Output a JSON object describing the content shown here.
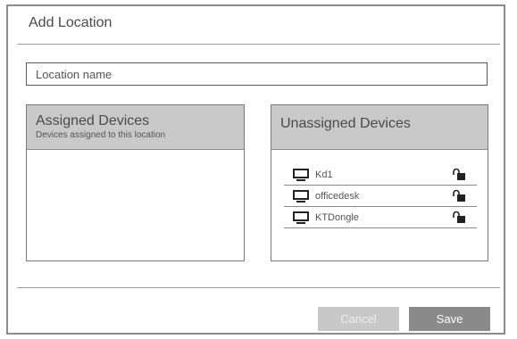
{
  "dialog": {
    "title": "Add Location"
  },
  "location_input": {
    "placeholder": "Location name",
    "value": ""
  },
  "assigned": {
    "title": "Assigned Devices",
    "subtitle": "Devices  assigned to this location",
    "items": []
  },
  "unassigned": {
    "title": "Unassigned Devices",
    "items": [
      {
        "name": "Kd1",
        "icon": "monitor-icon",
        "lock": "unlocked-lock-icon"
      },
      {
        "name": "officedesk",
        "icon": "monitor-icon",
        "lock": "unlocked-lock-icon"
      },
      {
        "name": "KTDongle",
        "icon": "monitor-icon",
        "lock": "unlocked-lock-icon"
      }
    ]
  },
  "buttons": {
    "cancel": "Cancel",
    "save": "Save"
  },
  "colors": {
    "header": "#c9c9c9",
    "save": "#8a8a8a",
    "cancel": "#c8c8c8"
  }
}
